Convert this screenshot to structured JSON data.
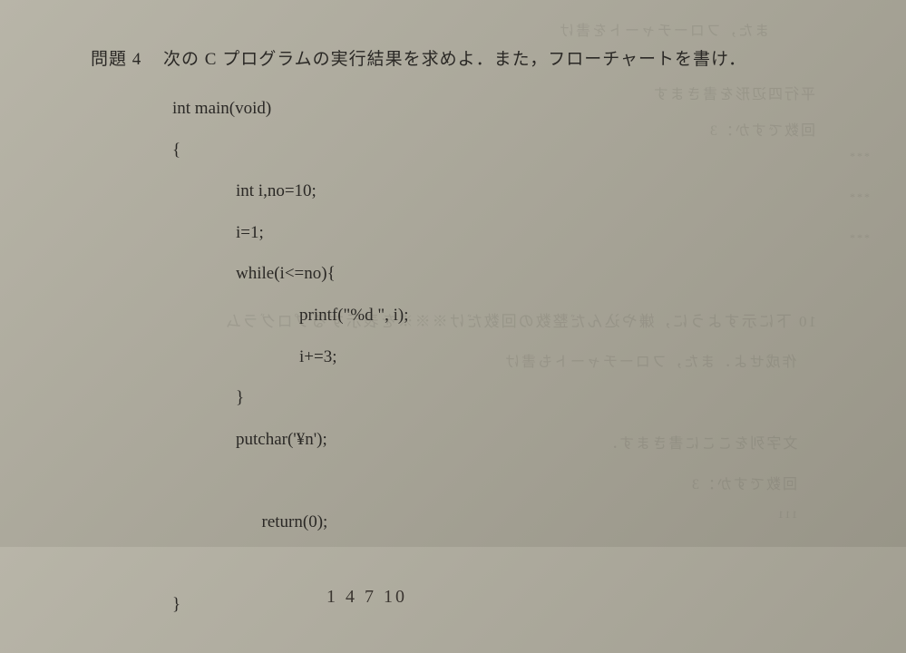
{
  "problem": {
    "number": "問題 4",
    "statement": "次の C プログラムの実行結果を求めよ．また，フローチャートを書け．"
  },
  "code": {
    "line1": "int main(void)",
    "line2": "{",
    "line3": "int i,no=10;",
    "line4": "i=1;",
    "line5": "while(i<=no){",
    "line6": "printf(\"%d \", i);",
    "line7": "i+=3;",
    "line8": "}",
    "line9": "putchar('¥n');",
    "line10": "return(0);",
    "line11": "}"
  },
  "handwritten_answer": "1 4 7 10",
  "ghost": {
    "g1": "また，フローチャートを書け",
    "g2": "平行四辺形を書きます",
    "g3": "回数ですか：3",
    "g4": "***",
    "g5": "***",
    "g6": "***",
    "g7": "10 下に示すように，嫌や込んだ整数の回数だけ※※※を表示するプログラム",
    "g8": "作成せよ．また，フローチャートも書け",
    "g9": "文字列をここに書きます．",
    "g10": "回数ですか：3",
    "g11": "111"
  }
}
